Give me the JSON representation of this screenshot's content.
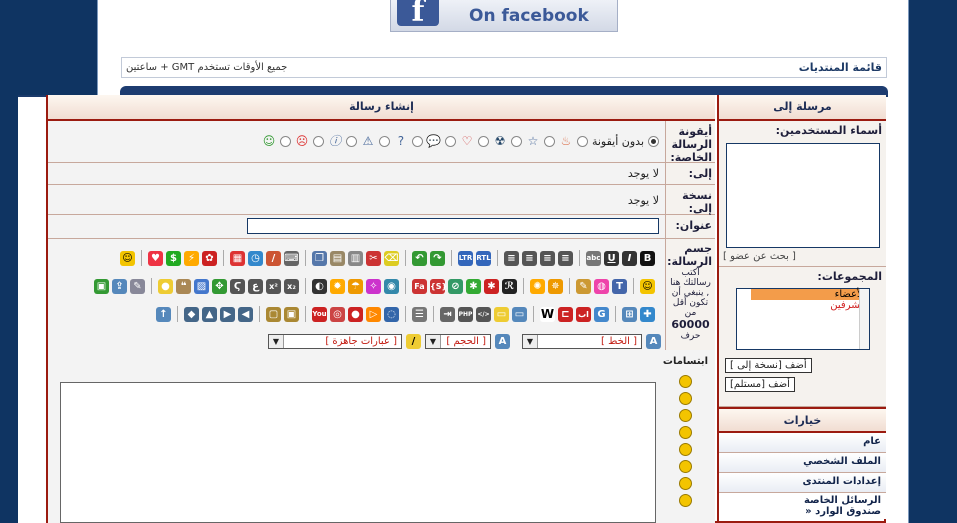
{
  "banner": {
    "text": "On facebook",
    "logo": "f"
  },
  "navbar": {
    "forum_list": "قائمة المنتديات",
    "timezone": "جميع الأوقات تستخدم GMT + ساعتين"
  },
  "compose": {
    "title": "إنشاء رسالة",
    "icon_label": "أيقونة الرسالة الخاصة:",
    "no_icon": "بدون أيقونة",
    "to_label": "إلى:",
    "to_value": "لا يوجد",
    "cc_label": "نسخة إلى:",
    "cc_value": "لا يوجد",
    "subject_label": "عنوان:",
    "body_label": "جسم الرسالة:",
    "body_hint": "اكتب رسالتك هنا , ينبغي أن تكون أقل من",
    "body_max": "60000",
    "body_unit": "حرف",
    "smilies_label": "ابتسامات",
    "select_font": "[ الخط ]",
    "select_size": "[ الحجم ]",
    "select_phrases": "[ عبارات جاهزة ]"
  },
  "sidebar": {
    "send_to_title": "مرسلة إلى",
    "usernames_label": "أسماء المستخدمين:",
    "find_member": "[ بحث عن عضو ]",
    "groups_label": "المجموعات:",
    "groups": [
      "الأعضاء",
      "مشرفين"
    ],
    "add_cc": "أضف [نسخة إلى ]",
    "add_to": "أضف [مستلم]",
    "options_title": "خيارات",
    "options": [
      "عام",
      "الملف الشخصي",
      "إعدادات المنتدى",
      "الرسائل الخاصة",
      "» صندوق الوارد"
    ]
  },
  "colors": {
    "accent": "#9b1b10",
    "navy": "#0f3462"
  }
}
